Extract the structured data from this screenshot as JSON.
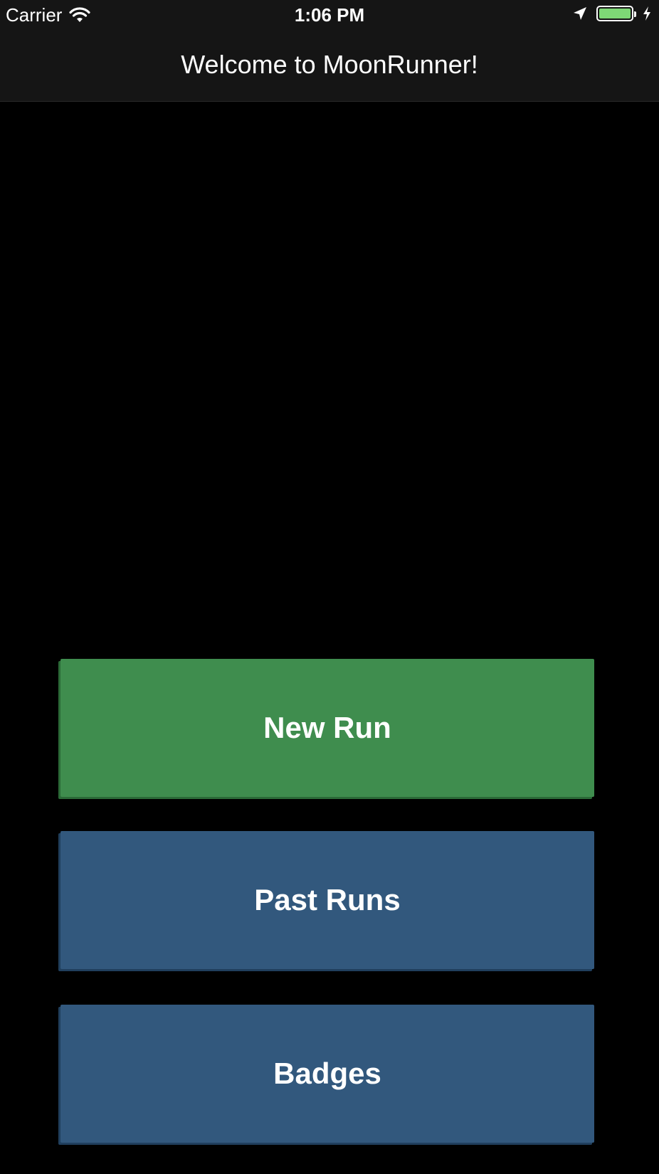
{
  "status_bar": {
    "carrier": "Carrier",
    "time": "1:06 PM",
    "icons": [
      "wifi-icon",
      "location-arrow-icon",
      "battery-icon",
      "charging-bolt-icon"
    ],
    "battery_color": "#7ed876"
  },
  "nav": {
    "title": "Welcome to MoonRunner!"
  },
  "buttons": {
    "new_run": "New Run",
    "past_runs": "Past Runs",
    "badges": "Badges"
  },
  "colors": {
    "background": "#000000",
    "nav_bar": "#151515",
    "new_run": "#3f8d4e",
    "secondary": "#32587d",
    "text": "#ffffff"
  }
}
